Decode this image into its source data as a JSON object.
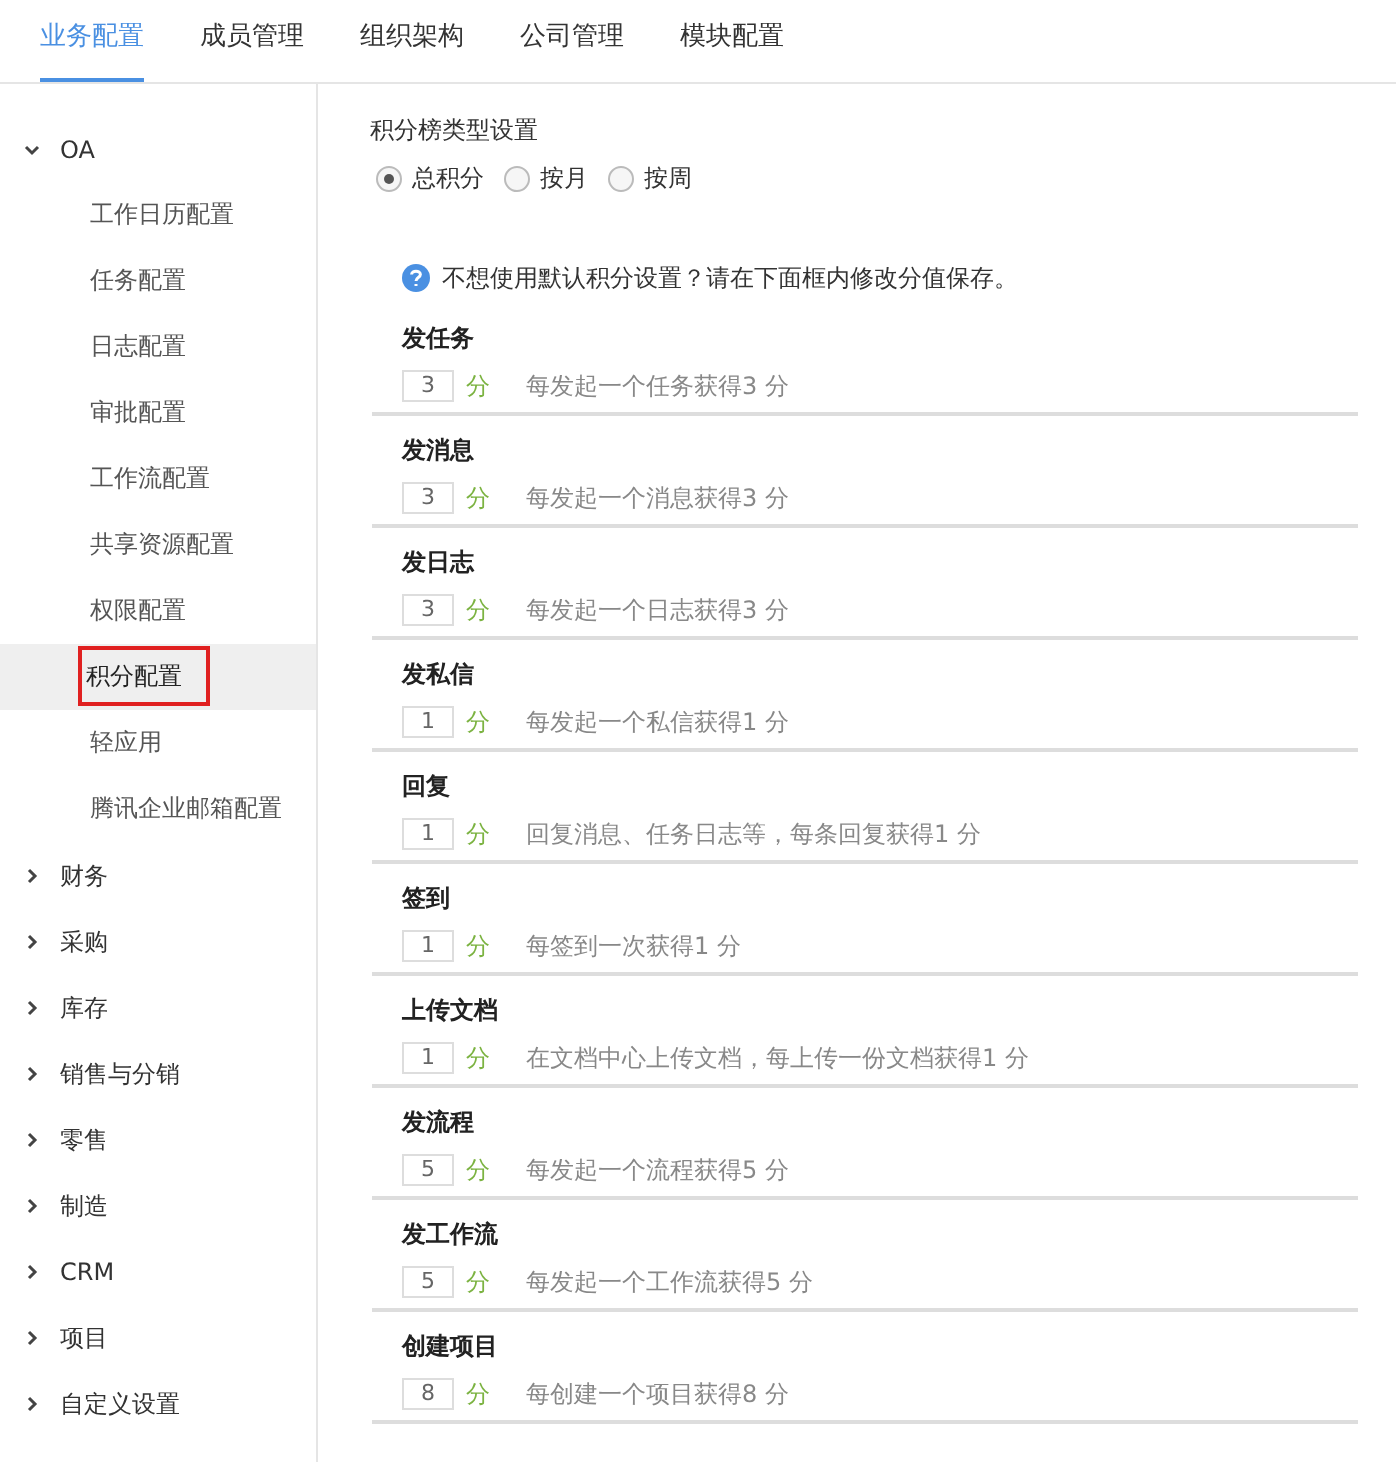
{
  "tabs": [
    {
      "label": "业务配置",
      "selected": true
    },
    {
      "label": "成员管理",
      "selected": false
    },
    {
      "label": "组织架构",
      "selected": false
    },
    {
      "label": "公司管理",
      "selected": false
    },
    {
      "label": "模块配置",
      "selected": false
    }
  ],
  "sidebar": {
    "items": [
      {
        "label": "OA",
        "expanded": true,
        "children": [
          {
            "label": "工作日历配置",
            "selected": false,
            "outlined": false
          },
          {
            "label": "任务配置",
            "selected": false,
            "outlined": false
          },
          {
            "label": "日志配置",
            "selected": false,
            "outlined": false
          },
          {
            "label": "审批配置",
            "selected": false,
            "outlined": false
          },
          {
            "label": "工作流配置",
            "selected": false,
            "outlined": false
          },
          {
            "label": "共享资源配置",
            "selected": false,
            "outlined": false
          },
          {
            "label": "权限配置",
            "selected": false,
            "outlined": false
          },
          {
            "label": "积分配置",
            "selected": true,
            "outlined": true
          },
          {
            "label": "轻应用",
            "selected": false,
            "outlined": false
          },
          {
            "label": "腾讯企业邮箱配置",
            "selected": false,
            "outlined": false
          }
        ]
      },
      {
        "label": "财务",
        "expanded": false
      },
      {
        "label": "采购",
        "expanded": false
      },
      {
        "label": "库存",
        "expanded": false
      },
      {
        "label": "销售与分销",
        "expanded": false
      },
      {
        "label": "零售",
        "expanded": false
      },
      {
        "label": "制造",
        "expanded": false
      },
      {
        "label": "CRM",
        "expanded": false
      },
      {
        "label": "项目",
        "expanded": false
      },
      {
        "label": "自定义设置",
        "expanded": false
      }
    ]
  },
  "ranking_type": {
    "title": "积分榜类型设置",
    "options": [
      {
        "label": "总积分",
        "selected": true
      },
      {
        "label": "按月",
        "selected": false
      },
      {
        "label": "按周",
        "selected": false
      }
    ]
  },
  "hint": "不想使用默认积分设置？请在下面框内修改分值保存。",
  "rules": [
    {
      "title": "发任务",
      "value": "3",
      "unit": "分",
      "description": "每发起一个任务获得3 分"
    },
    {
      "title": "发消息",
      "value": "3",
      "unit": "分",
      "description": "每发起一个消息获得3 分"
    },
    {
      "title": "发日志",
      "value": "3",
      "unit": "分",
      "description": "每发起一个日志获得3 分"
    },
    {
      "title": "发私信",
      "value": "1",
      "unit": "分",
      "description": "每发起一个私信获得1 分"
    },
    {
      "title": "回复",
      "value": "1",
      "unit": "分",
      "description": "回复消息、任务日志等，每条回复获得1 分"
    },
    {
      "title": "签到",
      "value": "1",
      "unit": "分",
      "description": "每签到一次获得1 分"
    },
    {
      "title": "上传文档",
      "value": "1",
      "unit": "分",
      "description": "在文档中心上传文档，每上传一份文档获得1 分"
    },
    {
      "title": "发流程",
      "value": "5",
      "unit": "分",
      "description": "每发起一个流程获得5 分"
    },
    {
      "title": "发工作流",
      "value": "5",
      "unit": "分",
      "description": "每发起一个工作流获得5 分"
    },
    {
      "title": "创建项目",
      "value": "8",
      "unit": "分",
      "description": "每创建一个项目获得8 分"
    }
  ]
}
